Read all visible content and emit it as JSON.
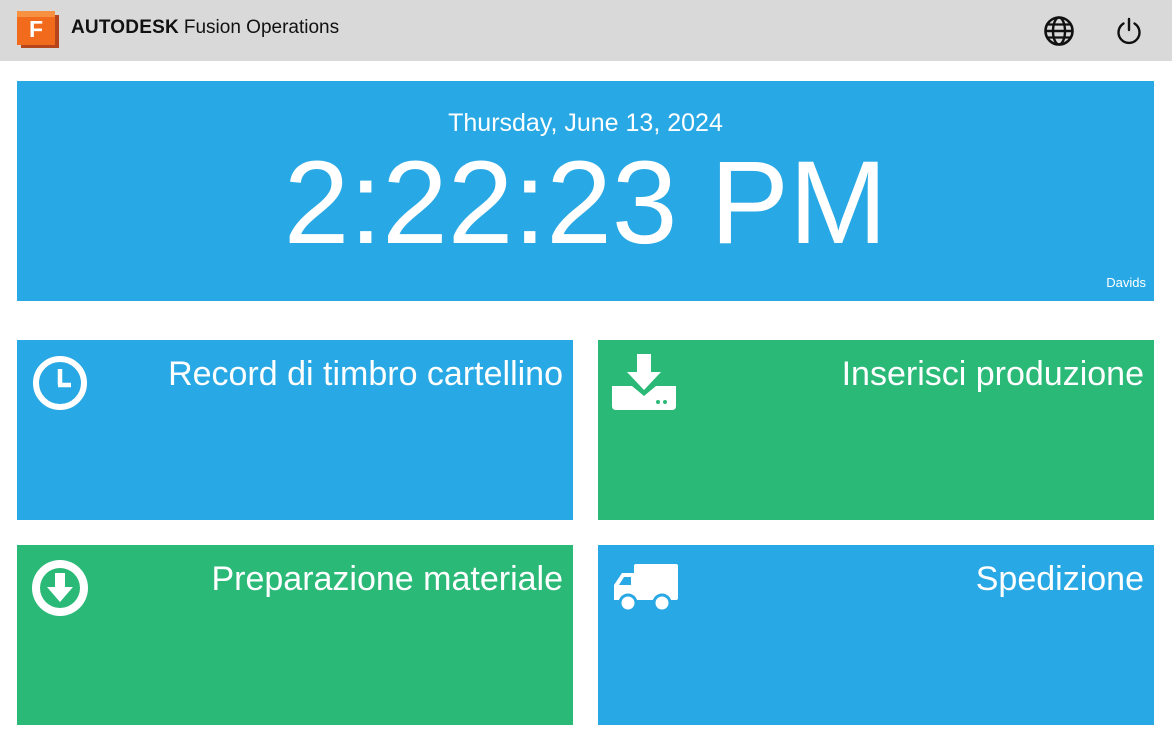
{
  "header": {
    "company": "AUTODESK",
    "product": "Fusion Operations",
    "logo_letter": "F",
    "logo_color": "#f26b1d",
    "background": "#d9d9d9",
    "icons": [
      "globe-icon",
      "power-icon"
    ]
  },
  "clock": {
    "date": "Thursday, June 13, 2024",
    "time": "2:22:23 PM",
    "user": "Davids",
    "background": "#28a8e4"
  },
  "tiles": [
    {
      "label": "Record di timbro cartellino",
      "icon": "clock-icon",
      "color": "#28a8e4"
    },
    {
      "label": "Inserisci produzione",
      "icon": "download-tray-icon",
      "color": "#2bb978"
    },
    {
      "label": "Preparazione materiale",
      "icon": "arrow-down-circle-icon",
      "color": "#2bb978"
    },
    {
      "label": "Spedizione",
      "icon": "truck-icon",
      "color": "#28a8e4"
    }
  ]
}
